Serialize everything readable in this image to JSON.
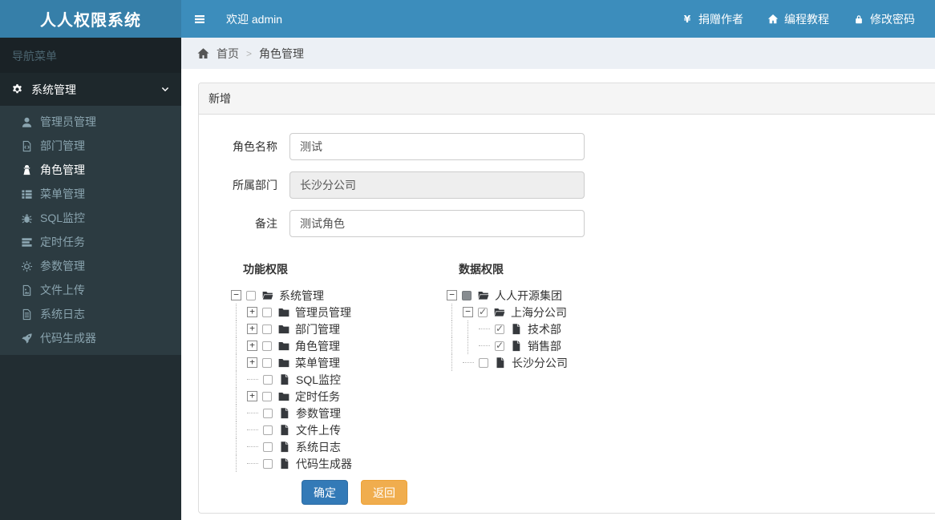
{
  "app": {
    "title": "人人权限系统"
  },
  "navbar": {
    "welcome": "欢迎 admin",
    "links": [
      {
        "icon": "yen-icon",
        "label": "捐赠作者"
      },
      {
        "icon": "home-icon",
        "label": "编程教程"
      },
      {
        "icon": "lock-icon",
        "label": "修改密码"
      }
    ]
  },
  "sidebar": {
    "header": "导航菜单",
    "root": {
      "icon": "gear-icon",
      "label": "系统管理"
    },
    "items": [
      {
        "icon": "user-icon",
        "label": "管理员管理",
        "active": false
      },
      {
        "icon": "file-code-icon",
        "label": "部门管理",
        "active": false
      },
      {
        "icon": "user-secret-icon",
        "label": "角色管理",
        "active": true
      },
      {
        "icon": "list-icon",
        "label": "菜单管理",
        "active": false
      },
      {
        "icon": "bug-icon",
        "label": "SQL监控",
        "active": false
      },
      {
        "icon": "tasks-icon",
        "label": "定时任务",
        "active": false
      },
      {
        "icon": "sun-icon",
        "label": "参数管理",
        "active": false
      },
      {
        "icon": "file-image-icon",
        "label": "文件上传",
        "active": false
      },
      {
        "icon": "file-text-icon",
        "label": "系统日志",
        "active": false
      },
      {
        "icon": "rocket-icon",
        "label": "代码生成器",
        "active": false
      }
    ]
  },
  "breadcrumb": {
    "home": "首页",
    "separator": ">",
    "current": "角色管理"
  },
  "panel": {
    "title": "新增",
    "form": [
      {
        "label": "角色名称",
        "value": "测试",
        "disabled": false
      },
      {
        "label": "所属部门",
        "value": "长沙分公司",
        "disabled": true
      },
      {
        "label": "备注",
        "value": "测试角色",
        "disabled": false
      }
    ],
    "func_tree": {
      "title": "功能权限",
      "nodes": [
        {
          "label": "系统管理",
          "icon": "folder-open",
          "expander": "minus",
          "checkbox": "unchecked",
          "guides": []
        },
        {
          "label": "管理员管理",
          "icon": "folder",
          "expander": "plus",
          "checkbox": "unchecked",
          "guides": [
            true
          ]
        },
        {
          "label": "部门管理",
          "icon": "folder",
          "expander": "plus",
          "checkbox": "unchecked",
          "guides": [
            true
          ]
        },
        {
          "label": "角色管理",
          "icon": "folder",
          "expander": "plus",
          "checkbox": "unchecked",
          "guides": [
            true
          ]
        },
        {
          "label": "菜单管理",
          "icon": "folder",
          "expander": "plus",
          "checkbox": "unchecked",
          "guides": [
            true
          ]
        },
        {
          "label": "SQL监控",
          "icon": "file",
          "expander": "line",
          "checkbox": "unchecked",
          "guides": [
            true
          ]
        },
        {
          "label": "定时任务",
          "icon": "folder",
          "expander": "plus",
          "checkbox": "unchecked",
          "guides": [
            true
          ]
        },
        {
          "label": "参数管理",
          "icon": "file",
          "expander": "line",
          "checkbox": "unchecked",
          "guides": [
            true
          ]
        },
        {
          "label": "文件上传",
          "icon": "file",
          "expander": "line",
          "checkbox": "unchecked",
          "guides": [
            true
          ]
        },
        {
          "label": "系统日志",
          "icon": "file",
          "expander": "line",
          "checkbox": "unchecked",
          "guides": [
            true
          ]
        },
        {
          "label": "代码生成器",
          "icon": "file",
          "expander": "line",
          "checkbox": "unchecked",
          "guides": [
            true
          ]
        }
      ]
    },
    "data_tree": {
      "title": "数据权限",
      "nodes": [
        {
          "label": "人人开源集团",
          "icon": "folder-open",
          "expander": "minus",
          "checkbox": "half",
          "guides": []
        },
        {
          "label": "上海分公司",
          "icon": "folder-open",
          "expander": "minus",
          "checkbox": "checked",
          "guides": [
            true
          ]
        },
        {
          "label": "技术部",
          "icon": "file",
          "expander": "line",
          "checkbox": "checked",
          "guides": [
            true,
            true
          ]
        },
        {
          "label": "销售部",
          "icon": "file",
          "expander": "line",
          "checkbox": "checked",
          "guides": [
            true,
            true
          ]
        },
        {
          "label": "长沙分公司",
          "icon": "file",
          "expander": "line",
          "checkbox": "unchecked",
          "guides": [
            true
          ]
        }
      ]
    },
    "buttons": {
      "confirm": "确定",
      "back": "返回"
    }
  },
  "colors": {
    "navbar": "#3c8dbc",
    "logo_bg": "#367fa9",
    "sidebar_bg": "#222d32",
    "sidebar_header_bg": "#1a2226",
    "submenu_bg": "#2c3b41",
    "breadcrumb_bg": "#ecf0f5",
    "confirm_button": "#337ab7",
    "back_button": "#f0ad4e"
  }
}
